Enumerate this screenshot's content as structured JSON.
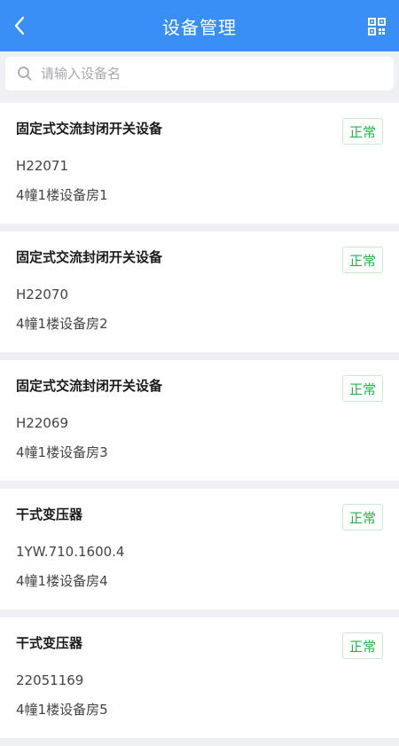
{
  "header": {
    "title": "设备管理",
    "back_icon": "chevron-left-icon",
    "scan_icon": "qr-code-icon"
  },
  "search": {
    "placeholder": "请输入设备名",
    "value": ""
  },
  "status_color": "#27b14b",
  "accent_color": "#3a8ff7",
  "devices": [
    {
      "name": "固定式交流封闭开关设备",
      "code": "H22071",
      "location": "4幢1楼设备房1",
      "status": "正常"
    },
    {
      "name": "固定式交流封闭开关设备",
      "code": "H22070",
      "location": "4幢1楼设备房2",
      "status": "正常"
    },
    {
      "name": "固定式交流封闭开关设备",
      "code": "H22069",
      "location": "4幢1楼设备房3",
      "status": "正常"
    },
    {
      "name": "干式变压器",
      "code": "1YW.710.1600.4",
      "location": "4幢1楼设备房4",
      "status": "正常"
    },
    {
      "name": "干式变压器",
      "code": "22051169",
      "location": "4幢1楼设备房5",
      "status": "正常"
    }
  ]
}
